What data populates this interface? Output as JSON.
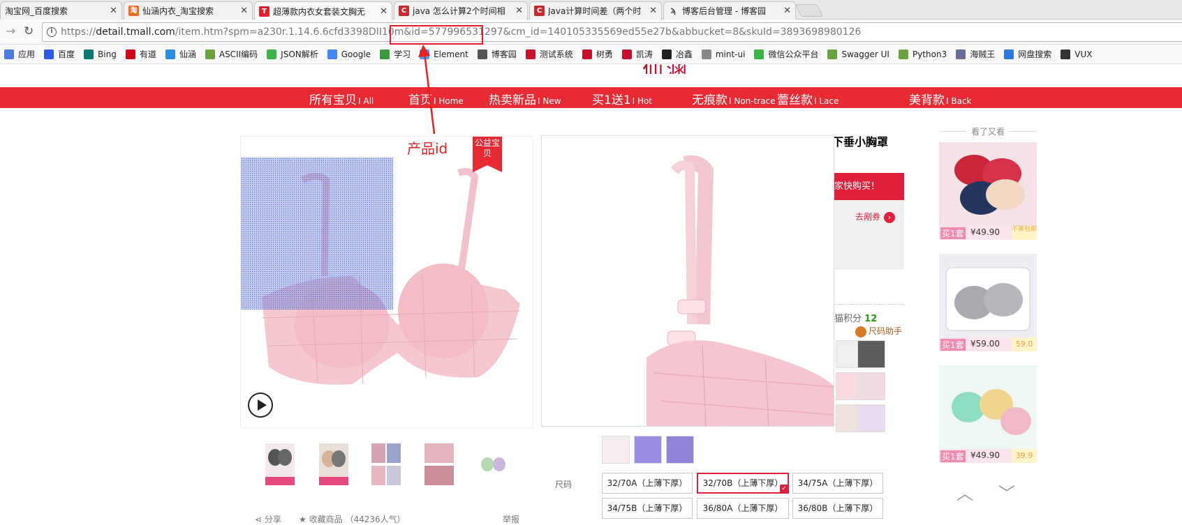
{
  "tabs": [
    {
      "title": "淘宝网_百度搜索",
      "icon": "none",
      "color": "#e9e9e9"
    },
    {
      "title": "仙涵内衣_淘宝搜索",
      "icon": "taobao-icon",
      "color": "#f26b21"
    },
    {
      "title": "超薄款内衣女套装文胸无",
      "icon": "tmall-icon",
      "color": "#e0202a"
    },
    {
      "title": "java 怎么计算2个时间相",
      "icon": "csdn-icon",
      "color": "#c9282d"
    },
    {
      "title": "Java计算时间差（两个时",
      "icon": "csdn-icon",
      "color": "#c9282d"
    },
    {
      "title": "博客后台管理 - 博客园",
      "icon": "cnblogs-icon",
      "color": "#555555"
    }
  ],
  "address": {
    "scheme": "https://",
    "domain": "detail.tmall.com",
    "path": "/item.htm?spm=a230r.1.14.6.6cfd3398DII10m&id=577996531297&cm_id=140105335569ed55e27b&abbucket=8&skuId=3893698980126"
  },
  "bookmarks": [
    {
      "label": "应用",
      "color": "#4a7be0"
    },
    {
      "label": "百度",
      "color": "#2d5be3"
    },
    {
      "label": "Bing",
      "color": "#0b7a75"
    },
    {
      "label": "有道",
      "color": "#d0021b"
    },
    {
      "label": "仙涵",
      "color": "#2a8ce0"
    },
    {
      "label": "ASCII编码",
      "color": "#6aa23e"
    },
    {
      "label": "JSON解析",
      "color": "#3bb54a"
    },
    {
      "label": "Google",
      "color": "#4285f4"
    },
    {
      "label": "学习",
      "color": "#3a9b3a"
    },
    {
      "label": "Element",
      "color": "#409eff"
    },
    {
      "label": "博客园",
      "color": "#555555"
    },
    {
      "label": "测试系统",
      "color": "#c8102e"
    },
    {
      "label": "树勇",
      "color": "#c8102e"
    },
    {
      "label": "凯涛",
      "color": "#c8102e"
    },
    {
      "label": "冶鑫",
      "color": "#222222"
    },
    {
      "label": "mint-ui",
      "color": "#888888"
    },
    {
      "label": "微信公众平台",
      "color": "#3bb54a"
    },
    {
      "label": "Swagger UI",
      "color": "#6aa23e"
    },
    {
      "label": "Python3",
      "color": "#6aa23e"
    },
    {
      "label": "海贼王",
      "color": "#6b6b9a"
    },
    {
      "label": "网盘搜索",
      "color": "#2a7ae2"
    },
    {
      "label": "VUX",
      "color": "#333333"
    }
  ],
  "category_nav": [
    {
      "label": "所有宝贝",
      "en": "I All"
    },
    {
      "label": "首页",
      "en": "I Home"
    },
    {
      "label": "热卖新品",
      "en": "I New"
    },
    {
      "label": "买1送1",
      "en": "I Hot"
    },
    {
      "label": "无痕款",
      "en": "I Non-trace"
    },
    {
      "label": "蕾丝款",
      "en": "I Lace"
    },
    {
      "label": "美背款",
      "en": "I Back"
    }
  ],
  "gallery": {
    "charity_badge": "公益宝贝",
    "share": "分享",
    "favorite": "收藏商品",
    "favorite_count": "（44236人气）",
    "report": "举报"
  },
  "product": {
    "title_fragment": "下垂小胸罩",
    "promo_fragment": "家快购买！",
    "coupon": "去剐券",
    "points_label": "猫积分",
    "points_value": "12",
    "size_helper": "尺码助手",
    "size_label": "尺码",
    "sizes": [
      "32/70A（上薄下厚）",
      "32/70B（上薄下厚）",
      "34/75A（上薄下厚）",
      "34/75B（上薄下厚）",
      "36/80A（上薄下厚）",
      "36/80B（上薄下厚）"
    ],
    "selected_size_index": 1
  },
  "sidebar": {
    "heading": "看了又看",
    "items": [
      {
        "buy": "买1套",
        "price": "¥49.90",
        "extra": "不莱包邮",
        "color": "#f2c6cf"
      },
      {
        "buy": "买1套",
        "price": "¥59.00",
        "extra": "59.0",
        "color": "#e6e6ec"
      },
      {
        "buy": "买1套",
        "price": "¥49.90",
        "extra": "39.9",
        "color": "#d9f1ea"
      }
    ]
  },
  "annotation": {
    "label": "产品id",
    "color": "#e0202a"
  }
}
